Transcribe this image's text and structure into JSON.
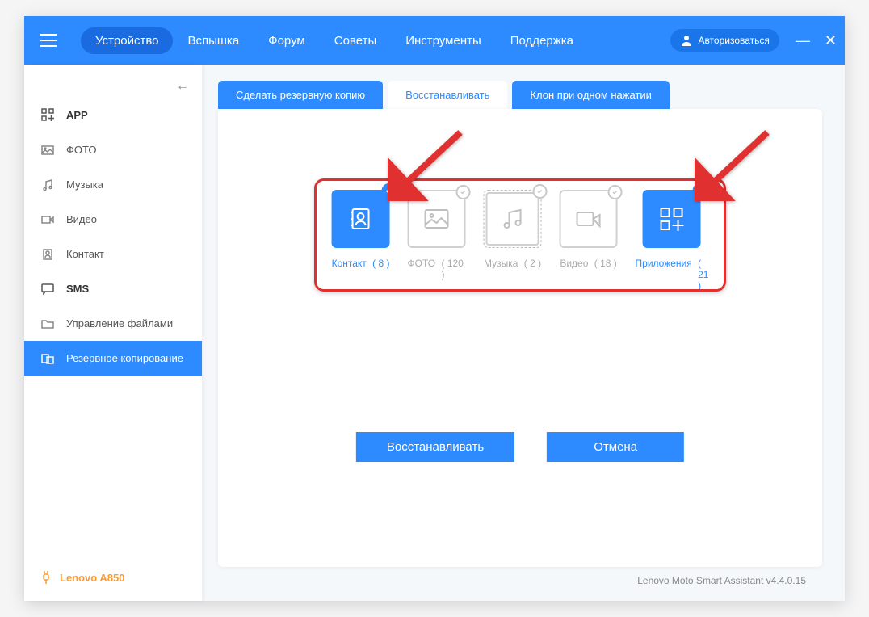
{
  "nav": {
    "items": [
      "Устройство",
      "Вспышка",
      "Форум",
      "Советы",
      "Инструменты",
      "Поддержка"
    ],
    "active_index": 0,
    "login_label": "Авторизоваться"
  },
  "sidebar": {
    "items": [
      {
        "label": "APP",
        "icon": "grid-plus-icon",
        "bold": true
      },
      {
        "label": "ФОТО",
        "icon": "photo-icon"
      },
      {
        "label": "Музыка",
        "icon": "music-icon"
      },
      {
        "label": "Видео",
        "icon": "video-icon"
      },
      {
        "label": "Контакт",
        "icon": "contact-icon"
      },
      {
        "label": "SMS",
        "icon": "sms-icon",
        "bold": true
      },
      {
        "label": "Управление файлами",
        "icon": "folder-icon"
      },
      {
        "label": "Резервное копирование",
        "icon": "backup-icon",
        "active": true
      }
    ],
    "device_name": "Lenovo A850"
  },
  "tabs": {
    "items": [
      "Сделать резервную копию",
      "Восстанавливать",
      "Клон при одном нажатии"
    ],
    "active_index": 1
  },
  "cards": [
    {
      "label": "Контакт",
      "count": "( 8 )",
      "selected": true,
      "dashed": false,
      "icon": "contact-card-icon"
    },
    {
      "label": "ФОТО",
      "count": "( 120 )",
      "selected": false,
      "dashed": false,
      "icon": "photo-card-icon"
    },
    {
      "label": "Музыка",
      "count": "( 2 )",
      "selected": false,
      "dashed": true,
      "icon": "music-card-icon"
    },
    {
      "label": "Видео",
      "count": "( 18 )",
      "selected": false,
      "dashed": false,
      "icon": "video-card-icon"
    },
    {
      "label": "Приложения",
      "count": "( 21 )",
      "selected": true,
      "dashed": false,
      "icon": "apps-card-icon"
    }
  ],
  "buttons": {
    "restore": "Восстанавливать",
    "cancel": "Отмена"
  },
  "footer": "Lenovo Moto Smart Assistant v4.4.0.15"
}
